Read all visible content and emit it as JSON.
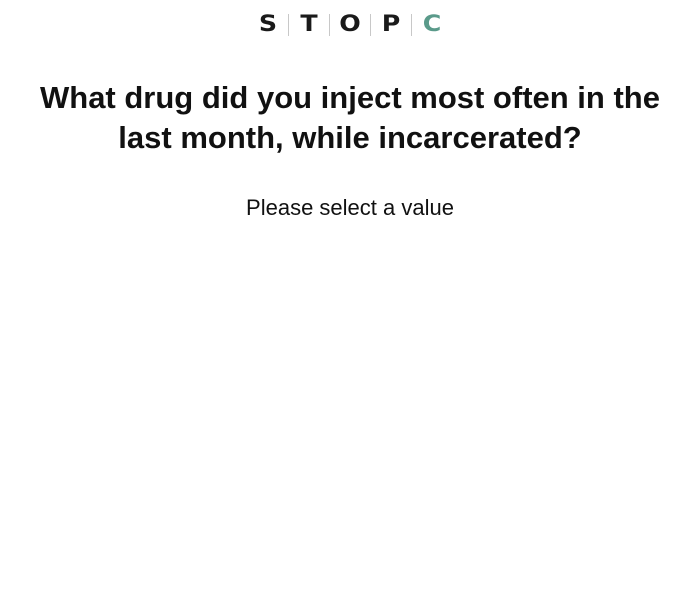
{
  "logo": {
    "letters": [
      "S",
      "T",
      "O",
      "P",
      "C"
    ],
    "accent_color": "#5a9a8a",
    "text_color": "#1a1a1a"
  },
  "question": {
    "title": "What drug did you inject most often in the last month, while incarcerated?"
  },
  "validation": {
    "hint": "Please select a value"
  }
}
